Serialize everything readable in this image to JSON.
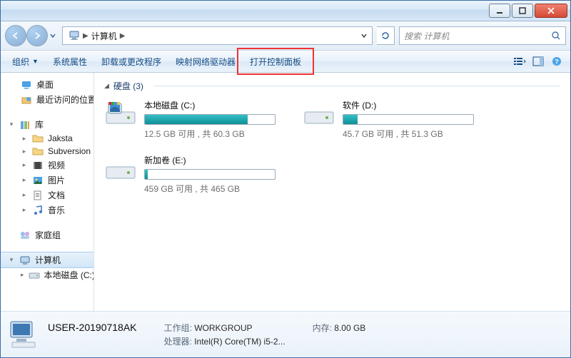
{
  "titlebar": {},
  "addressbar": {
    "crumb_root": "计算机",
    "search_placeholder": "搜索 计算机"
  },
  "cmdbar": {
    "organize": "组织",
    "sys_props": "系统属性",
    "uninstall": "卸载或更改程序",
    "map_drive": "映射网络驱动器",
    "open_cpl": "打开控制面板"
  },
  "tree": {
    "desktop": "桌面",
    "recent": "最近访问的位置",
    "library": "库",
    "jaksta": "Jaksta",
    "subversion": "Subversion",
    "video": "视频",
    "pictures": "图片",
    "documents": "文档",
    "music": "音乐",
    "homegroup": "家庭组",
    "computer": "计算机",
    "local_c": "本地磁盘 (C:)"
  },
  "section_title": "硬盘 (3)",
  "drives": [
    {
      "name": "本地磁盘 (C:)",
      "stat": "12.5 GB 可用 , 共 60.3 GB",
      "pct": 79
    },
    {
      "name": "软件 (D:)",
      "stat": "45.7 GB 可用 , 共 51.3 GB",
      "pct": 11
    },
    {
      "name": "新加卷 (E:)",
      "stat": "459 GB 可用 , 共 465 GB",
      "pct": 2
    }
  ],
  "details": {
    "name": "USER-20190718AK",
    "wg_label": "工作组:",
    "wg_value": "WORKGROUP",
    "cpu_label": "处理器:",
    "cpu_value": "Intel(R) Core(TM) i5-2...",
    "mem_label": "内存:",
    "mem_value": "8.00 GB"
  }
}
